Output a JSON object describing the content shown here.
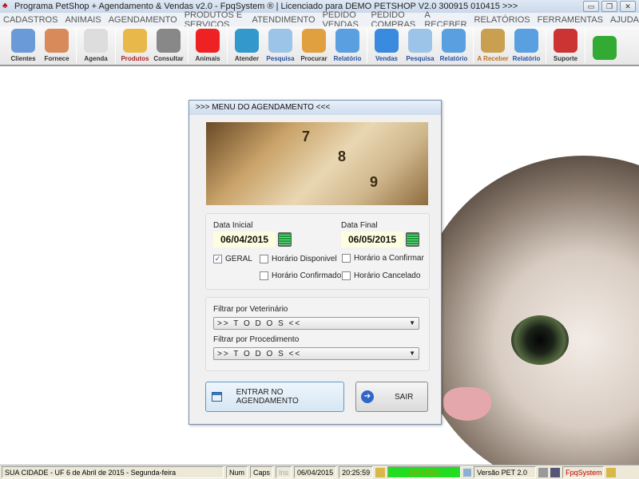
{
  "window": {
    "title": "Programa PetShop + Agendamento & Vendas v2.0 - FpqSystem ® | Licenciado para  DEMO PETSHOP V2.0 300915 010415 >>>",
    "min": "▭",
    "max": "❐",
    "close": "✕"
  },
  "menu": [
    "CADASTROS",
    "ANIMAIS",
    "AGENDAMENTO",
    "PRODUTOS E SERVIÇOS",
    "ATENDIMENTO",
    "PEDIDO VENDAS",
    "PEDIDO COMPRAS",
    "A RECEBER",
    "RELATÓRIOS",
    "FERRAMENTAS",
    "AJUDA"
  ],
  "toolbar": [
    {
      "label": "Clientes",
      "icon": "users-icon"
    },
    {
      "label": "Fornece",
      "icon": "supplier-icon"
    },
    {
      "label": "Agenda",
      "icon": "agenda-icon"
    },
    {
      "label": "Produtos",
      "icon": "boxes-icon"
    },
    {
      "label": "Consultar",
      "icon": "barcode-icon"
    },
    {
      "label": "Animais",
      "icon": "paw-icon"
    },
    {
      "label": "Atender",
      "icon": "paw-cross-icon"
    },
    {
      "label": "Pesquisa",
      "icon": "search-doc-icon"
    },
    {
      "label": "Procurar",
      "icon": "drawer-icon"
    },
    {
      "label": "Relatório",
      "icon": "printer-icon"
    },
    {
      "label": "Vendas",
      "icon": "monitor-icon"
    },
    {
      "label": "Pesquisa",
      "icon": "search-doc-icon"
    },
    {
      "label": "Relatório",
      "icon": "printer-icon"
    },
    {
      "label": "A Receber",
      "icon": "money-icon"
    },
    {
      "label": "Relatório",
      "icon": "printer-icon"
    },
    {
      "label": "Suporte",
      "icon": "support-icon"
    },
    {
      "label": "",
      "icon": "exit-icon"
    }
  ],
  "dialog": {
    "title": ">>>  MENU DO AGENDAMENTO  <<<",
    "banner_numbers": [
      "7",
      "8",
      "9"
    ],
    "data_inicial_label": "Data Inicial",
    "data_inicial": "06/04/2015",
    "data_final_label": "Data Final",
    "data_final": "06/05/2015",
    "checks": {
      "geral": "GERAL",
      "disponivel": "Horário  Disponivel",
      "confirmado": "Horário Confirmado",
      "a_confirmar": "Horário a Confirmar",
      "cancelado": "Horário Cancelado"
    },
    "check_mark": "✓",
    "vet_label": "Filtrar por Veterinário",
    "vet_value": ">> T O D O S <<",
    "proc_label": "Filtrar por Procedimento",
    "proc_value": ">> T O D O S <<",
    "enter_label": "ENTRAR NO AGENDAMENTO",
    "exit_label": "SAIR",
    "arrow": "▼",
    "exit_glyph": "➔"
  },
  "status": {
    "city": "SUA CIDADE - UF  6 de Abril de 2015 - Segunda-feira",
    "num": "Num",
    "caps": "Caps",
    "ins": "Ins",
    "date": "06/04/2015",
    "time": "20:25:59",
    "user": "MASTER",
    "version": "Versão PET 2.0",
    "brand": "FpqSystem"
  },
  "colors": {
    "user_bg": "#22dd22",
    "brand": "#cc0000"
  }
}
